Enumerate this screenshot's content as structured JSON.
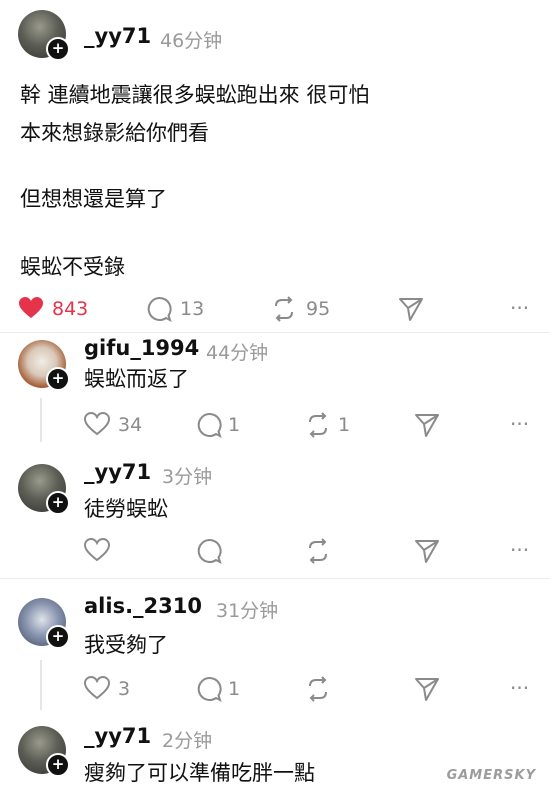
{
  "post": {
    "username": "_yy71",
    "time": "46分钟",
    "lines": [
      "幹 連續地震讓很多蜈蚣跑出來 很可怕",
      "本來想錄影給你們看",
      "",
      "但想想還是算了",
      "",
      "蜈蚣不受錄"
    ],
    "likes": "843",
    "comments": "13",
    "reposts": "95"
  },
  "replies": [
    {
      "username": "gifu_1994",
      "time": "44分钟",
      "text": "蜈蚣而返了",
      "likes": "34",
      "comments": "1",
      "reposts": "1"
    },
    {
      "username": "_yy71",
      "time": "3分钟",
      "text": "徒勞蜈蚣",
      "likes": "",
      "comments": "",
      "reposts": ""
    },
    {
      "username": "alis._2310",
      "time": "31分钟",
      "text": "我受夠了",
      "likes": "3",
      "comments": "1",
      "reposts": ""
    },
    {
      "username": "_yy71",
      "time": "2分钟",
      "text": "瘦夠了可以準備吃胖一點"
    }
  ],
  "watermark": "GAMERSKY",
  "colors": {
    "like_active": "#e5334a",
    "icon_gray": "#8a8a8a"
  }
}
